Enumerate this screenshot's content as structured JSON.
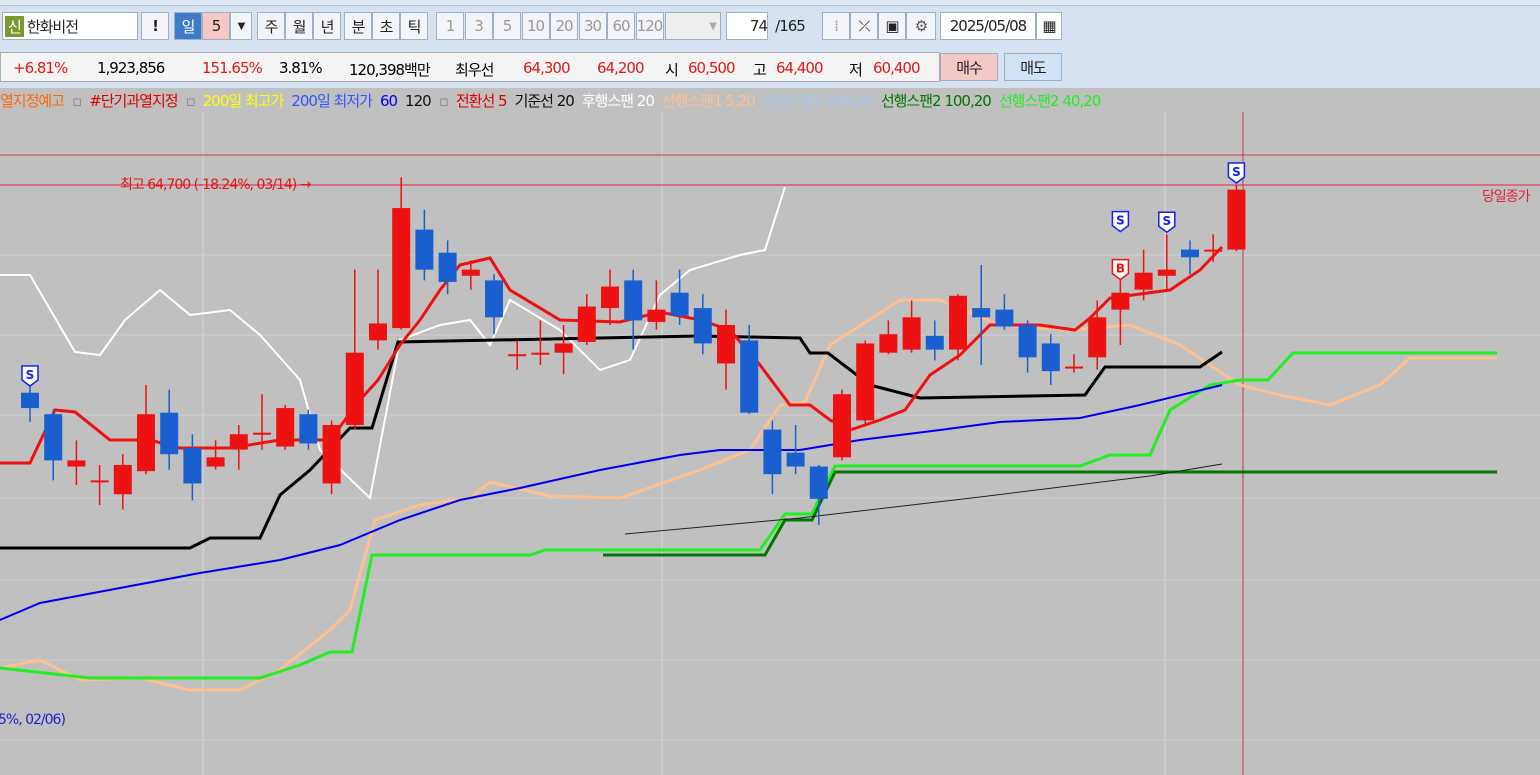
{
  "toolbar": {
    "market_badge": "신",
    "stock_name": "한화비전",
    "alert": "!",
    "period_day": "일",
    "period_n": "5",
    "dropdown": "▼",
    "week": "주",
    "month": "월",
    "year": "년",
    "minute": "분",
    "second": "초",
    "tick": "틱",
    "intervals": [
      "1",
      "3",
      "5",
      "10",
      "20",
      "30",
      "60",
      "120"
    ],
    "count": "74",
    "total": "/165",
    "date": "2025/05/08"
  },
  "quote": {
    "change_pct": "+6.81%",
    "volume": "1,923,856",
    "vol_ratio": "151.65%",
    "turnover": "3.81%",
    "amount": "120,398백만",
    "best_label": "최우선",
    "ask": "64,300",
    "bid": "64,200",
    "open_label": "시",
    "open": "60,500",
    "high_label": "고",
    "high": "64,400",
    "low_label": "저",
    "low": "60,400",
    "buy": "매수",
    "sell": "매도"
  },
  "legend": [
    {
      "text": "열지정예고",
      "color": "#ff6a00"
    },
    {
      "text": "▫",
      "color": "#888"
    },
    {
      "text": "#단기과열지정",
      "color": "#e00000"
    },
    {
      "text": "▫",
      "color": "#888"
    },
    {
      "text": "200일 최고가",
      "color": "#ffff00"
    },
    {
      "text": "200일 최저가",
      "color": "#3355ff"
    },
    {
      "text": "60",
      "color": "#0000ee"
    },
    {
      "text": "120",
      "color": "#111"
    },
    {
      "text": "▫",
      "color": "#888"
    },
    {
      "text": "전환선 5",
      "color": "#e00000"
    },
    {
      "text": "기준선 20",
      "color": "#111"
    },
    {
      "text": "후행스팬 20",
      "color": "#ffffff"
    },
    {
      "text": "선행스팬1 5,20",
      "color": "#ffc090"
    },
    {
      "text": "선행스팬2 200,20",
      "color": "#a8c8f0"
    },
    {
      "text": "선행스팬2 100,20",
      "color": "#007700"
    },
    {
      "text": "선행스팬2 40,20",
      "color": "#22ee22"
    }
  ],
  "annotations": {
    "high": "최고 64,700 (-18.24%, 03/14) →",
    "low": "5%, 02/06)",
    "close_label": "당일종가",
    "signals": [
      {
        "i": 0,
        "t": "S"
      },
      {
        "i": 47,
        "t": "S"
      },
      {
        "i": 47,
        "t": "B"
      },
      {
        "i": 49,
        "t": "S"
      },
      {
        "i": 52,
        "t": "S"
      }
    ]
  },
  "chart_data": {
    "type": "candlestick",
    "price_high": 64700,
    "ohlc": [
      [
        51200,
        52500,
        49300,
        50200
      ],
      [
        49800,
        50100,
        45500,
        46800
      ],
      [
        46400,
        48100,
        45200,
        46800
      ],
      [
        45500,
        46500,
        43900,
        45500
      ],
      [
        44600,
        47200,
        43600,
        46500
      ],
      [
        46100,
        51700,
        45900,
        49800
      ],
      [
        49900,
        51400,
        46200,
        47200
      ],
      [
        47600,
        48500,
        44200,
        45300
      ],
      [
        46400,
        48100,
        46200,
        47000
      ],
      [
        47500,
        49100,
        46200,
        48500
      ],
      [
        48600,
        51100,
        47500,
        48600
      ],
      [
        47700,
        50400,
        47500,
        50200
      ],
      [
        49800,
        50100,
        47500,
        47900
      ],
      [
        45300,
        49400,
        44600,
        49100
      ],
      [
        49100,
        59200,
        48800,
        53800
      ],
      [
        54600,
        59200,
        54000,
        55700
      ],
      [
        55400,
        65200,
        55300,
        63200
      ],
      [
        61800,
        63100,
        58500,
        59200
      ],
      [
        60300,
        61100,
        57600,
        58400
      ],
      [
        58800,
        59800,
        57900,
        59200
      ],
      [
        58500,
        58900,
        55000,
        56100
      ],
      [
        53700,
        54600,
        52700,
        53700
      ],
      [
        53800,
        55900,
        53000,
        53800
      ],
      [
        53800,
        55600,
        52400,
        54400
      ],
      [
        54500,
        57600,
        54300,
        56800
      ],
      [
        56700,
        59200,
        55600,
        58100
      ],
      [
        58500,
        59200,
        54000,
        55900
      ],
      [
        55800,
        58500,
        55300,
        56600
      ],
      [
        57700,
        59200,
        55600,
        56200
      ],
      [
        56700,
        57600,
        53700,
        54400
      ],
      [
        53100,
        56600,
        51400,
        55600
      ],
      [
        54600,
        55600,
        49800,
        49900
      ],
      [
        48800,
        49400,
        44600,
        45900
      ],
      [
        47300,
        49100,
        45900,
        46400
      ],
      [
        46400,
        46500,
        42600,
        44300
      ],
      [
        47000,
        51400,
        46800,
        51100
      ],
      [
        49400,
        54600,
        49100,
        54400
      ],
      [
        53800,
        55900,
        53700,
        55000
      ],
      [
        54000,
        57200,
        53800,
        56100
      ],
      [
        54900,
        55900,
        53300,
        54000
      ],
      [
        54000,
        57600,
        53300,
        57500
      ],
      [
        56700,
        59500,
        53000,
        56100
      ],
      [
        56600,
        57600,
        55300,
        55500
      ],
      [
        55600,
        55900,
        52500,
        53500
      ],
      [
        54400,
        55000,
        51700,
        52600
      ],
      [
        52900,
        53700,
        52500,
        52900
      ],
      [
        53500,
        57200,
        52700,
        56100
      ],
      [
        56600,
        59200,
        54300,
        57700
      ],
      [
        57900,
        60500,
        57200,
        59000
      ],
      [
        58800,
        61500,
        57900,
        59200
      ],
      [
        60500,
        61100,
        58900,
        60000
      ],
      [
        60500,
        61500,
        59700,
        60500
      ],
      [
        60500,
        64700,
        60400,
        64400
      ]
    ]
  }
}
